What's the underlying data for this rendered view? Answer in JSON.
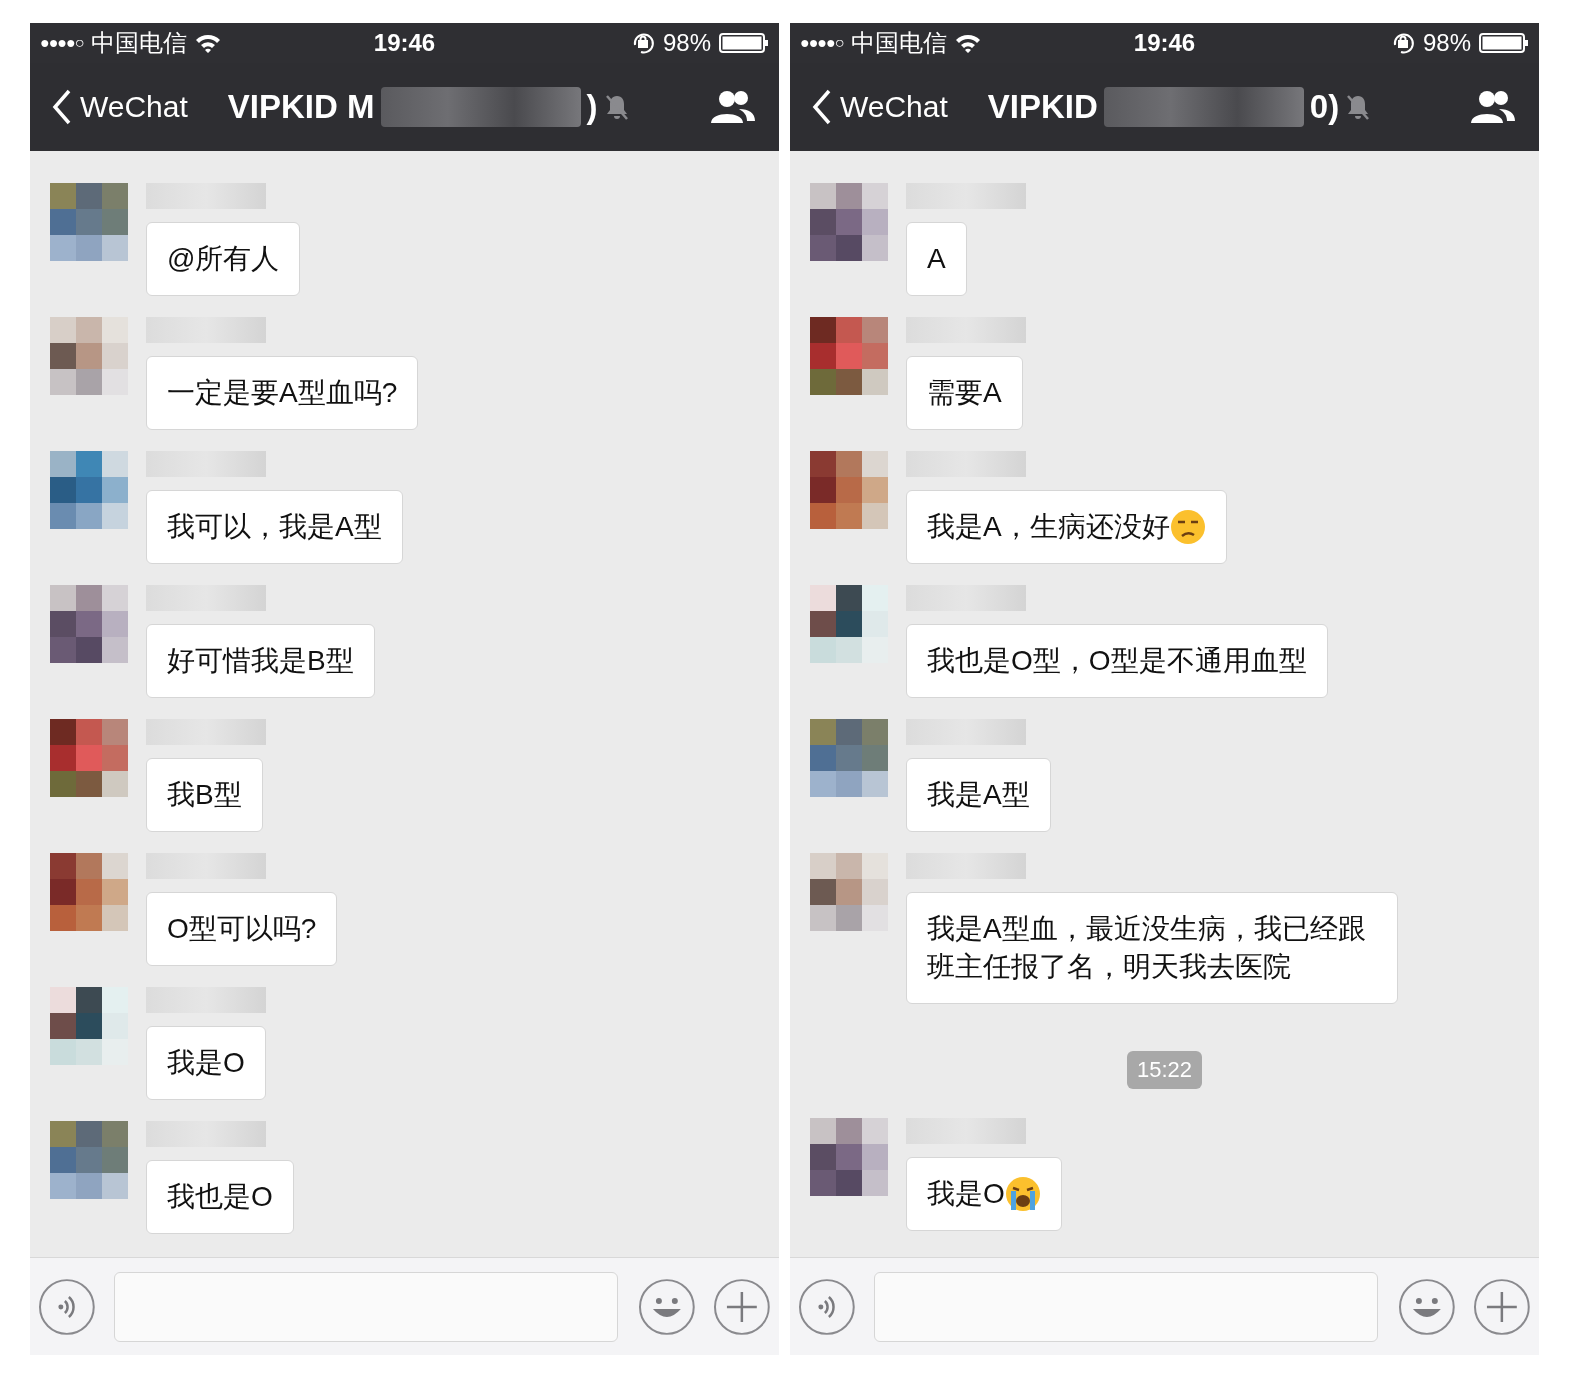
{
  "phones": [
    {
      "status_bar": {
        "signal": "●●●●○",
        "carrier": "中国电信",
        "time": "19:46",
        "battery": "98%"
      },
      "nav": {
        "back": "WeChat",
        "title": "VIPKID M",
        "title_end": ")"
      },
      "messages": [
        {
          "kind": "message",
          "text": "@所有人"
        },
        {
          "kind": "message",
          "text": "一定是要A型血吗?"
        },
        {
          "kind": "message",
          "text": "我可以，我是A型"
        },
        {
          "kind": "message",
          "text": "好可惜我是B型"
        },
        {
          "kind": "message",
          "text": "我B型"
        },
        {
          "kind": "message",
          "text": "O型可以吗?"
        },
        {
          "kind": "message",
          "text": "我是O"
        },
        {
          "kind": "message",
          "text": "我也是O"
        }
      ]
    },
    {
      "status_bar": {
        "signal": "●●●●○",
        "carrier": "中国电信",
        "time": "19:46",
        "battery": "98%"
      },
      "nav": {
        "back": "WeChat",
        "title": "VIPKID",
        "title_end": "0)"
      },
      "messages": [
        {
          "kind": "message",
          "text": "A"
        },
        {
          "kind": "message",
          "text": "需要A"
        },
        {
          "kind": "message",
          "text": "我是A，生病还没好",
          "emoji": {
            "kind": "unamused"
          }
        },
        {
          "kind": "message",
          "text": "我也是O型，O型是不通用血型"
        },
        {
          "kind": "message",
          "text": "我是A型"
        },
        {
          "kind": "message",
          "text": "我是A型血，最近没生病，我已经跟班主任报了名，明天我去医院"
        },
        {
          "kind": "time",
          "text": "15:22"
        },
        {
          "kind": "message",
          "text": "我是O",
          "emoji": {
            "kind": "crying"
          }
        }
      ]
    }
  ]
}
